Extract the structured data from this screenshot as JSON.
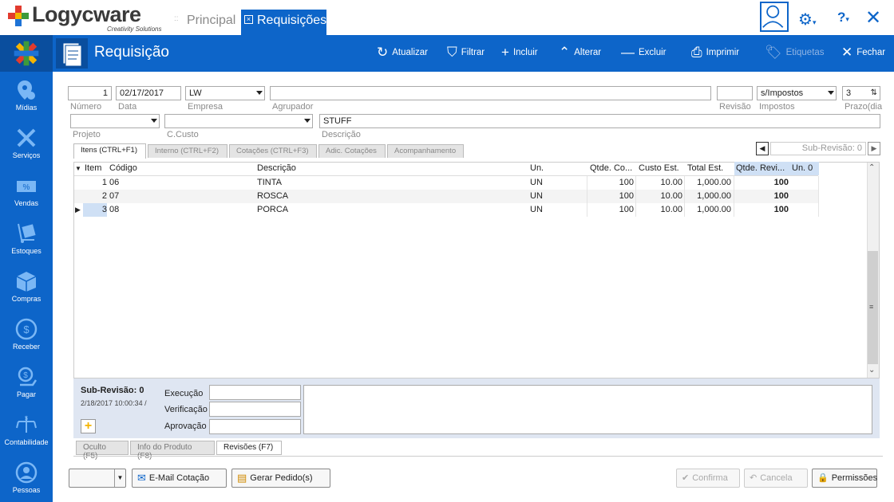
{
  "app": {
    "brand": "Logycware",
    "tagline": "Creativity Solutions",
    "tabs": [
      {
        "label": "Principal"
      },
      {
        "label": "Requisições"
      }
    ]
  },
  "header": {
    "title": "Requisição",
    "toolbar": {
      "atualizar": "Atualizar",
      "filtrar": "Filtrar",
      "incluir": "Incluir",
      "alterar": "Alterar",
      "excluir": "Excluir",
      "imprimir": "Imprimir",
      "etiquetas": "Etiquetas",
      "fechar": "Fechar"
    }
  },
  "sidebar": {
    "items": [
      {
        "label": "Mídias"
      },
      {
        "label": "Serviços"
      },
      {
        "label": "Vendas"
      },
      {
        "label": "Estoques"
      },
      {
        "label": "Compras"
      },
      {
        "label": "Receber"
      },
      {
        "label": "Pagar"
      },
      {
        "label": "Contabilidade"
      },
      {
        "label": "Pessoas"
      }
    ]
  },
  "form": {
    "numero": {
      "label": "Número",
      "value": "1"
    },
    "data": {
      "label": "Data",
      "value": "02/17/2017"
    },
    "empresa": {
      "label": "Empresa",
      "value": "LW"
    },
    "agrupador": {
      "label": "Agrupador",
      "value": ""
    },
    "revisao": {
      "label": "Revisão",
      "value": ""
    },
    "impostos": {
      "label": "Impostos",
      "value": "s/Impostos"
    },
    "prazo": {
      "label": "Prazo(dia",
      "value": "3"
    },
    "projeto": {
      "label": "Projeto",
      "value": ""
    },
    "ccusto": {
      "label": "C.Custo",
      "value": ""
    },
    "descricao": {
      "label": "Descrição",
      "value": "STUFF"
    }
  },
  "subtabs": [
    {
      "label": "Itens (CTRL+F1)"
    },
    {
      "label": "Interno (CTRL+F2)"
    },
    {
      "label": "Cotações (CTRL+F3)"
    },
    {
      "label": "Adic. Cotações"
    },
    {
      "label": "Acompanhamento"
    }
  ],
  "subrevision_nav": {
    "label": "Sub-Revisão: 0"
  },
  "grid": {
    "columns": [
      "Item",
      "Código",
      "Descrição",
      "Un.",
      "Qtde. Co...",
      "Custo Est.",
      "Total Est.",
      "Qtde. Revi...",
      "Un. 0"
    ],
    "rows": [
      {
        "item": "1",
        "codigo": "06",
        "descricao": "TINTA",
        "un": "UN",
        "qtde": "100",
        "custo": "10.00",
        "total": "1,000.00",
        "qtde_rev": "100"
      },
      {
        "item": "2",
        "codigo": "07",
        "descricao": "ROSCA",
        "un": "UN",
        "qtde": "100",
        "custo": "10.00",
        "total": "1,000.00",
        "qtde_rev": "100"
      },
      {
        "item": "3",
        "codigo": "08",
        "descricao": "PORCA",
        "un": "UN",
        "qtde": "100",
        "custo": "10.00",
        "total": "1,000.00",
        "qtde_rev": "100"
      }
    ]
  },
  "revision": {
    "title": "Sub-Revisão: 0",
    "timestamp": "2/18/2017 10:00:34 /",
    "execucao": "Execução",
    "verificacao": "Verificação",
    "aprovacao": "Aprovação"
  },
  "bottom_tabs": [
    {
      "label": "Oculto (F5)"
    },
    {
      "label": "Info do Produto (F8)"
    },
    {
      "label": "Revisões (F7)"
    }
  ],
  "buttons": {
    "email": "E-Mail Cotação",
    "gerar": "Gerar Pedido(s)",
    "confirma": "Confirma",
    "cancela": "Cancela",
    "permissoes": "Permissões"
  },
  "colors": {
    "primary": "#0d65c9",
    "sidebar_dark": "#0a4e9e"
  }
}
